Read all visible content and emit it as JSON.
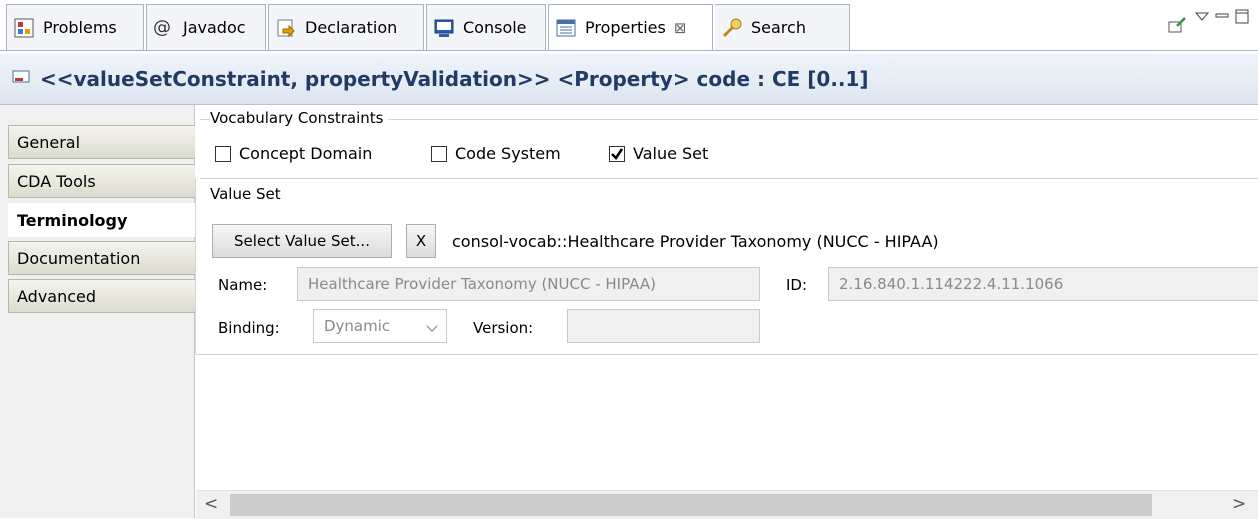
{
  "tabs": [
    {
      "label": "Problems",
      "icon": "problems-icon"
    },
    {
      "label": "Javadoc",
      "icon": "javadoc-icon"
    },
    {
      "label": "Declaration",
      "icon": "declaration-icon"
    },
    {
      "label": "Console",
      "icon": "console-icon"
    },
    {
      "label": "Properties",
      "icon": "properties-icon",
      "active": true,
      "close": "⊠"
    },
    {
      "label": "Search",
      "icon": "search-icon"
    }
  ],
  "header": {
    "title": "<<valueSetConstraint, propertyValidation>> <Property> code : CE [0..1]"
  },
  "nav": {
    "items": [
      {
        "label": "General"
      },
      {
        "label": "CDA Tools"
      },
      {
        "label": "Terminology",
        "selected": true
      },
      {
        "label": "Documentation"
      },
      {
        "label": "Advanced"
      }
    ]
  },
  "vocab": {
    "title": "Vocabulary Constraints",
    "concept_domain": {
      "label": "Concept Domain",
      "checked": false
    },
    "code_system": {
      "label": "Code System",
      "checked": false
    },
    "value_set": {
      "label": "Value Set",
      "checked": true
    }
  },
  "valueset": {
    "title": "Value Set",
    "select_button": "Select Value Set...",
    "clear_button": "X",
    "qualified_name": "consol-vocab::Healthcare Provider Taxonomy (NUCC - HIPAA)",
    "name_label": "Name:",
    "name_value": "Healthcare Provider Taxonomy (NUCC - HIPAA)",
    "id_label": "ID:",
    "id_value": "2.16.840.1.114222.4.11.1066",
    "binding_label": "Binding:",
    "binding_value": "Dynamic",
    "version_label": "Version:",
    "version_value": ""
  },
  "scroll": {
    "left": "<",
    "right": ">"
  }
}
